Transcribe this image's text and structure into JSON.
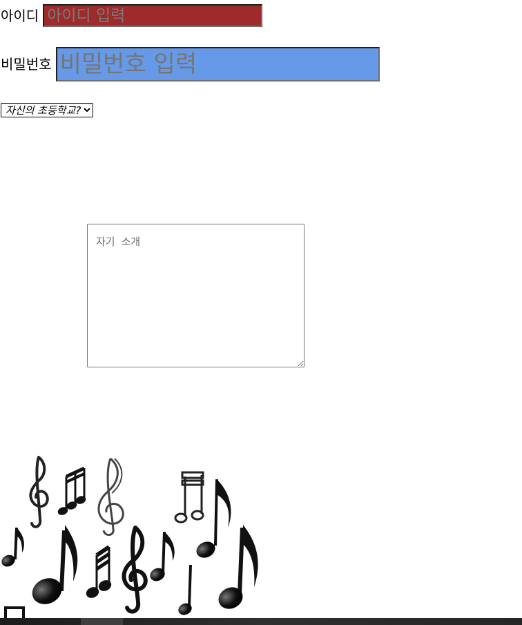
{
  "form": {
    "id_label": "아이디",
    "id_placeholder": "아이디 입력",
    "id_bg_color": "#9e2a2b",
    "password_label": "비밀번호",
    "password_placeholder": "비밀번호 입력",
    "password_bg_color": "#6699e8",
    "school_select": {
      "selected": "자신의 초등학교?",
      "options": [
        "자신의 초등학교?"
      ]
    },
    "intro_placeholder": "자기 소개"
  },
  "image": {
    "icon": "music-notes-image"
  }
}
